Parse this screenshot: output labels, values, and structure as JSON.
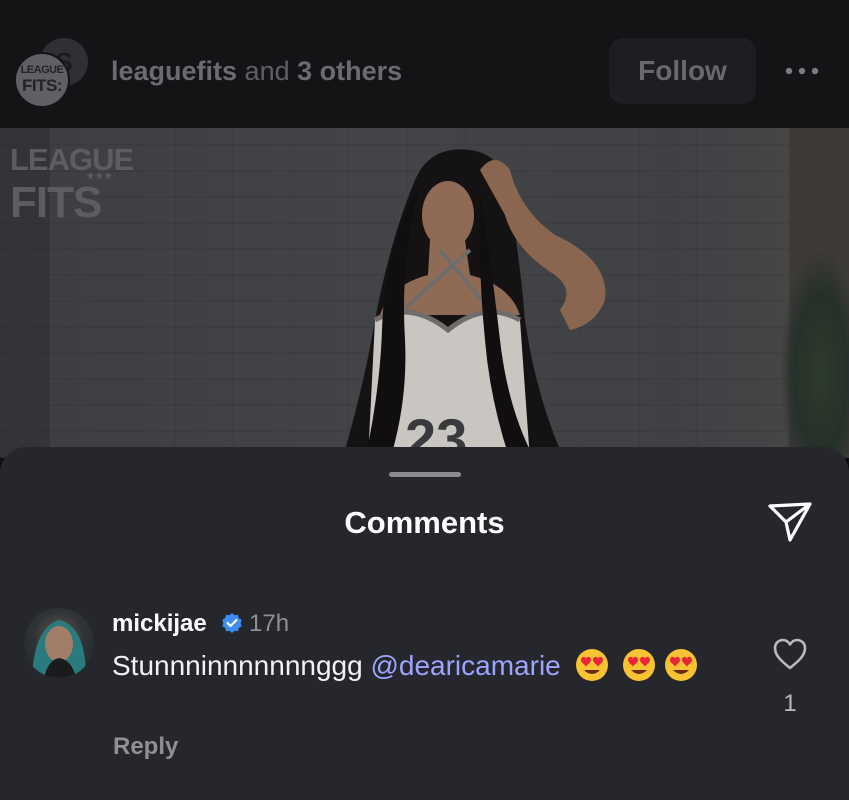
{
  "header": {
    "avatar_logo": {
      "line1": "LEAGUE",
      "line2": "FITS:"
    },
    "back_avatar_letter": "S",
    "title": {
      "username": "leaguefits",
      "connector": " and ",
      "others": "3 others"
    },
    "follow_label": "Follow",
    "more_icon": "more-horizontal-icon"
  },
  "post": {
    "watermark": {
      "line1": "LEAGUE",
      "line2": "FITS",
      "stars": "★★★"
    },
    "jersey_number": "23"
  },
  "comments_sheet": {
    "title": "Comments",
    "send_icon": "paper-plane-icon",
    "comments": [
      {
        "username": "mickijae",
        "verified": true,
        "time": "17h",
        "text": "Stunnninnnnnnnggg ",
        "mention": "@dearicamarie",
        "emoji_count": 3,
        "emoji": "heart-eyes-emoji",
        "reply_label": "Reply",
        "likes": "1"
      }
    ]
  },
  "colors": {
    "sheet_bg": "#25272c",
    "mention": "#9da4ff",
    "verified": "#3b8ef0"
  }
}
